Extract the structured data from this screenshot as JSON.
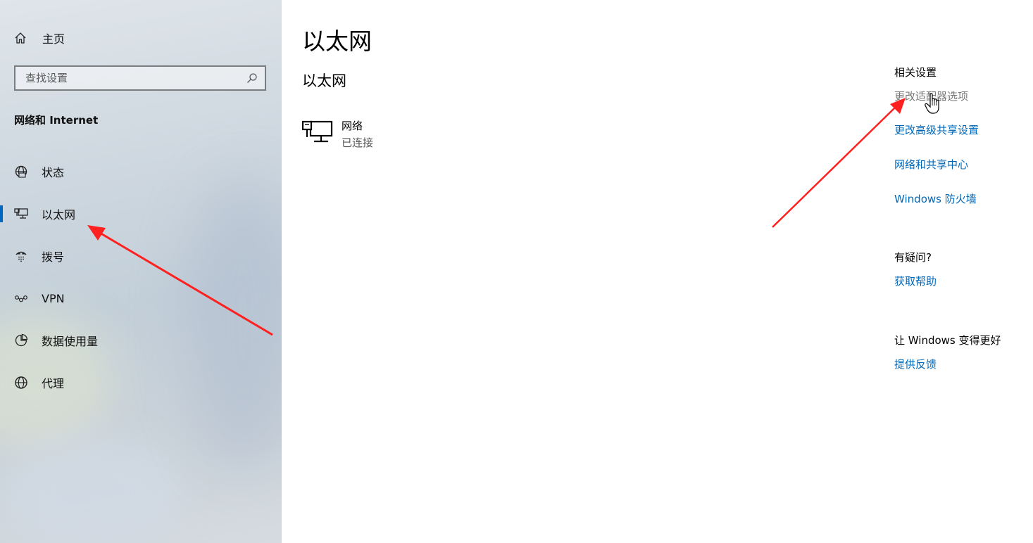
{
  "sidebar": {
    "home_label": "主页",
    "search_placeholder": "查找设置",
    "section_title": "网络和 Internet",
    "items": [
      {
        "label": "状态",
        "icon": "globe-status-icon",
        "selected": false
      },
      {
        "label": "以太网",
        "icon": "ethernet-icon",
        "selected": true
      },
      {
        "label": "拨号",
        "icon": "dialup-icon",
        "selected": false
      },
      {
        "label": "VPN",
        "icon": "vpn-icon",
        "selected": false
      },
      {
        "label": "数据使用量",
        "icon": "data-usage-icon",
        "selected": false
      },
      {
        "label": "代理",
        "icon": "globe-icon",
        "selected": false
      }
    ]
  },
  "main": {
    "title": "以太网",
    "subtitle": "以太网",
    "network": {
      "name": "网络",
      "status": "已连接",
      "icon": "ethernet-icon"
    }
  },
  "related": {
    "heading": "相关设置",
    "links": [
      "更改适配器选项",
      "更改高级共享设置",
      "网络和共享中心",
      "Windows 防火墙"
    ]
  },
  "help": {
    "heading": "有疑问?",
    "link": "获取帮助"
  },
  "feedback": {
    "heading": "让 Windows 变得更好",
    "link": "提供反馈"
  },
  "colors": {
    "accent": "#0067c0",
    "link": "#0067b8",
    "arrow": "#ff2020"
  }
}
